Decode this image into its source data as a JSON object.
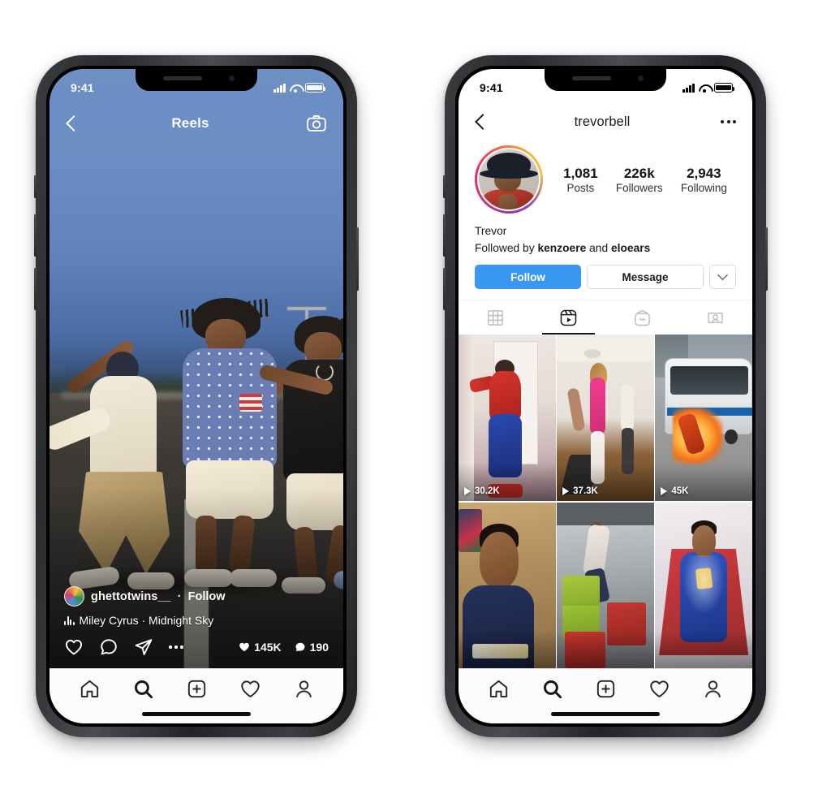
{
  "page": {
    "background": "#ffffff"
  },
  "phones": {
    "left": {
      "name": "reels-screen",
      "status_bar": {
        "time": "9:41",
        "signal_icon": "signal-bars-icon",
        "wifi_icon": "wifi-icon",
        "battery_icon": "battery-icon"
      },
      "header": {
        "back_icon": "chevron-left-icon",
        "title": "Reels",
        "camera_icon": "camera-icon"
      },
      "caption": {
        "avatar": "user-avatar",
        "username": "ghettotwins__",
        "separator": "·",
        "follow_label": "Follow",
        "music_icon": "music-bars-icon",
        "music_text": "Miley Cyrus · Midnight Sky",
        "actions": [
          {
            "name": "like-icon",
            "label": "heart"
          },
          {
            "name": "comment-icon",
            "label": "comment"
          },
          {
            "name": "share-icon",
            "label": "share"
          },
          {
            "name": "more-options-icon",
            "label": "more"
          }
        ],
        "like_count": "145K",
        "comment_count": "190"
      },
      "bottom_nav": [
        {
          "name": "nav-home",
          "icon": "home-icon",
          "active": false
        },
        {
          "name": "nav-search",
          "icon": "search-icon",
          "active": true
        },
        {
          "name": "nav-create",
          "icon": "plus-square-icon",
          "active": false
        },
        {
          "name": "nav-activity",
          "icon": "heart-icon",
          "active": false
        },
        {
          "name": "nav-profile",
          "icon": "person-icon",
          "active": false
        }
      ]
    },
    "right": {
      "name": "profile-screen",
      "status_bar": {
        "time": "9:41",
        "signal_icon": "signal-bars-icon",
        "wifi_icon": "wifi-icon",
        "battery_icon": "battery-icon"
      },
      "header": {
        "back_icon": "chevron-left-icon",
        "username": "trevorbell",
        "more_icon": "more-options-icon"
      },
      "stats": [
        {
          "number": "1,081",
          "label": "Posts"
        },
        {
          "number": "226k",
          "label": "Followers"
        },
        {
          "number": "2,943",
          "label": "Following"
        }
      ],
      "bio": {
        "display_name": "Trevor",
        "followed_by_prefix": "Followed by ",
        "followed_by_1": "kenzoere",
        "followed_by_mid": " and ",
        "followed_by_2": "eloears"
      },
      "actions": {
        "follow_label": "Follow",
        "follow_color": "#3897f0",
        "message_label": "Message",
        "caret_icon": "chevron-down-icon"
      },
      "tabs": [
        {
          "name": "tab-grid",
          "icon": "grid-icon",
          "active": false
        },
        {
          "name": "tab-reels",
          "icon": "reels-icon",
          "active": true
        },
        {
          "name": "tab-igtv",
          "icon": "igtv-icon",
          "active": false
        },
        {
          "name": "tab-tagged",
          "icon": "tagged-icon",
          "active": false
        }
      ],
      "grid": [
        {
          "name": "reel-thumb-1",
          "views": "30.2K",
          "play_icon": "play-icon"
        },
        {
          "name": "reel-thumb-2",
          "views": "37.3K",
          "play_icon": "play-icon"
        },
        {
          "name": "reel-thumb-3",
          "views": "45K",
          "play_icon": "play-icon"
        },
        {
          "name": "reel-thumb-4",
          "views": "",
          "play_icon": "play-icon"
        },
        {
          "name": "reel-thumb-5",
          "views": "",
          "play_icon": "play-icon"
        },
        {
          "name": "reel-thumb-6",
          "views": "",
          "play_icon": "play-icon"
        }
      ],
      "bottom_nav": [
        {
          "name": "nav-home",
          "icon": "home-icon",
          "active": false
        },
        {
          "name": "nav-search",
          "icon": "search-icon",
          "active": true
        },
        {
          "name": "nav-create",
          "icon": "plus-square-icon",
          "active": false
        },
        {
          "name": "nav-activity",
          "icon": "heart-icon",
          "active": false
        },
        {
          "name": "nav-profile",
          "icon": "person-icon",
          "active": false
        }
      ]
    }
  }
}
